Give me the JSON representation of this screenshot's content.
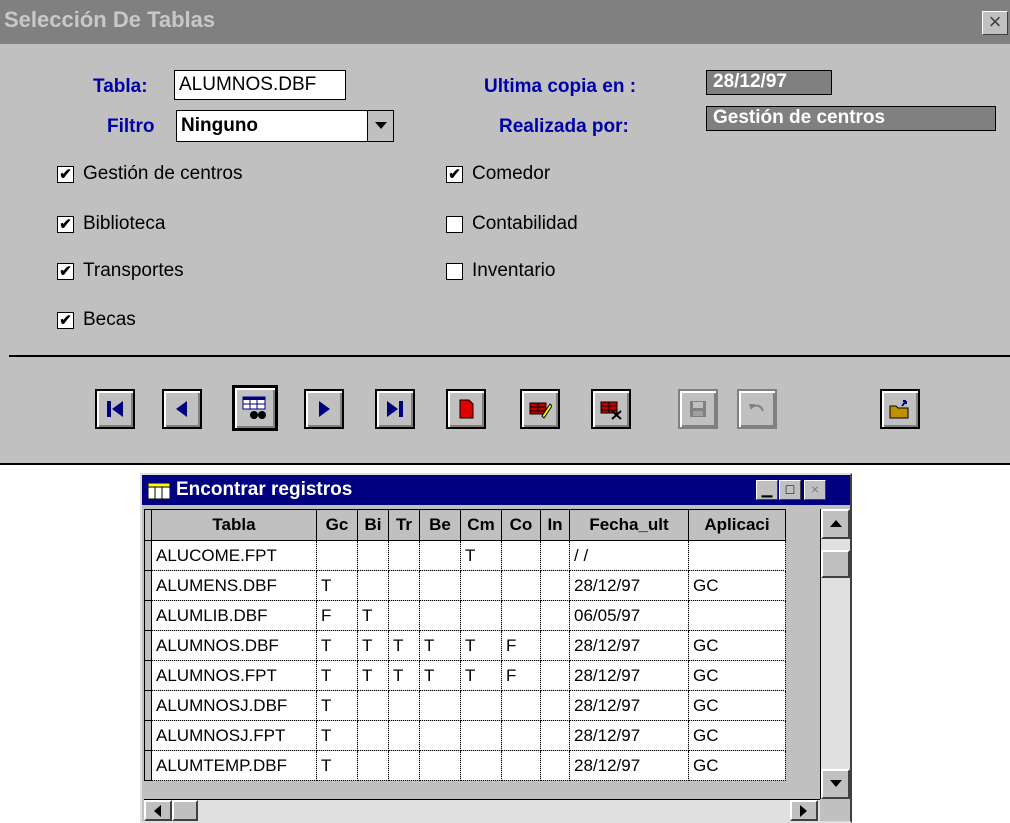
{
  "dialog": {
    "title": "Selección De Tablas",
    "close_glyph": "×",
    "tabla_label": "Tabla:",
    "tabla_value": "ALUMNOS.DBF",
    "filtro_label": "Filtro",
    "filtro_value": "Ninguno",
    "ultima_label": "Ultima copia en :",
    "ultima_value": "28/12/97",
    "realizada_label": "Realizada por:",
    "realizada_value": "Gestión de centros"
  },
  "checkboxes": [
    {
      "label": "Gestión de centros",
      "checked": true
    },
    {
      "label": "Biblioteca",
      "checked": true
    },
    {
      "label": "Transportes",
      "checked": true
    },
    {
      "label": "Becas",
      "checked": true
    },
    {
      "label": "Comedor",
      "checked": true
    },
    {
      "label": "Contabilidad",
      "checked": false
    },
    {
      "label": "Inventario",
      "checked": false
    }
  ],
  "toolbar": {
    "buttons": [
      {
        "name": "first-record-button",
        "icon": "first-icon",
        "enabled": true
      },
      {
        "name": "prev-record-button",
        "icon": "prev-icon",
        "enabled": true
      },
      {
        "name": "find-button",
        "icon": "binoculars-grid-icon",
        "enabled": true
      },
      {
        "name": "next-record-button",
        "icon": "next-icon",
        "enabled": true
      },
      {
        "name": "last-record-button",
        "icon": "last-icon",
        "enabled": true
      },
      {
        "name": "new-record-button",
        "icon": "new-page-icon",
        "enabled": true
      },
      {
        "name": "edit-record-button",
        "icon": "edit-icon",
        "enabled": true
      },
      {
        "name": "delete-record-button",
        "icon": "delete-icon",
        "enabled": true
      },
      {
        "name": "save-button",
        "icon": "disk-icon",
        "enabled": false
      },
      {
        "name": "undo-button",
        "icon": "undo-icon",
        "enabled": false
      },
      {
        "name": "exit-button",
        "icon": "folder-exit-icon",
        "enabled": true
      }
    ]
  },
  "grid": {
    "title": "Encontrar registros",
    "columns": [
      "Tabla",
      "Gc",
      "Bi",
      "Tr",
      "Be",
      "Cm",
      "Co",
      "In",
      "Fecha_ult",
      "Aplicaci"
    ],
    "rows": [
      [
        "ALUCOME.FPT",
        "",
        "",
        "",
        "",
        "T",
        "",
        "",
        " / /",
        ""
      ],
      [
        "ALUMENS.DBF",
        "T",
        "",
        "",
        "",
        "",
        "",
        "",
        "28/12/97",
        "GC"
      ],
      [
        "ALUMLIB.DBF",
        "F",
        "T",
        "",
        "",
        "",
        "",
        "",
        "06/05/97",
        ""
      ],
      [
        "ALUMNOS.DBF",
        "T",
        "T",
        "T",
        "T",
        "T",
        "F",
        "",
        "28/12/97",
        "GC"
      ],
      [
        "ALUMNOS.FPT",
        "T",
        "T",
        "T",
        "T",
        "T",
        "F",
        "",
        "28/12/97",
        "GC"
      ],
      [
        "ALUMNOSJ.DBF",
        "T",
        "",
        "",
        "",
        "",
        "",
        "",
        "28/12/97",
        "GC"
      ],
      [
        "ALUMNOSJ.FPT",
        "T",
        "",
        "",
        "",
        "",
        "",
        "",
        "28/12/97",
        "GC"
      ],
      [
        "ALUMTEMP.DBF",
        "T",
        "",
        "",
        "",
        "",
        "",
        "",
        "28/12/97",
        "GC"
      ]
    ]
  },
  "colors": {
    "title_inactive": "#808080",
    "title_active": "#000080",
    "label_blue": "#0000a8",
    "face": "#c0c0c0"
  }
}
